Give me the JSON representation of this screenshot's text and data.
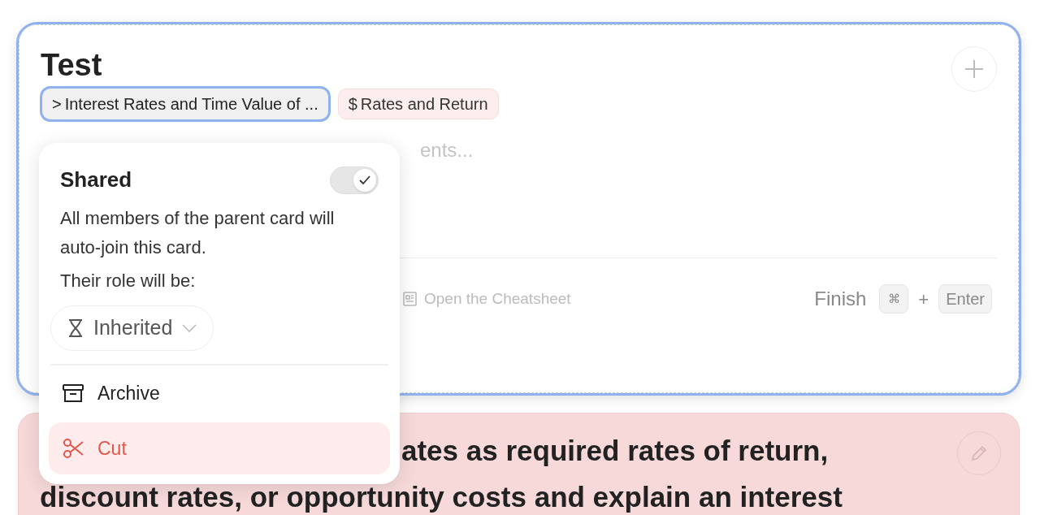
{
  "card": {
    "title": "Test",
    "chips": [
      {
        "kind": "parent",
        "icon": ">",
        "label": "Interest Rates and Time Value of ...",
        "selected": true
      },
      {
        "kind": "tag",
        "icon": "$",
        "label": "Rates and Return",
        "selected": false
      }
    ],
    "placeholder_fragment": "ents...",
    "cheatsheet_link": "Open the Cheatsheet",
    "finish": {
      "label": "Finish",
      "keys": [
        "⌘",
        "Enter"
      ],
      "joiner": "+"
    }
  },
  "popup": {
    "shared": {
      "label": "Shared",
      "on": true
    },
    "description": "All members of the parent card will auto-join this card.",
    "role_label": "Their role will be:",
    "role": "Inherited",
    "items": [
      {
        "kind": "archive",
        "label": "Archive",
        "selected": false
      },
      {
        "kind": "cut",
        "label": "Cut",
        "selected": true
      }
    ]
  },
  "next_card": {
    "lines": [
      "ates as required rates of return,",
      "discount rates, or opportunity costs and explain an interest"
    ]
  }
}
